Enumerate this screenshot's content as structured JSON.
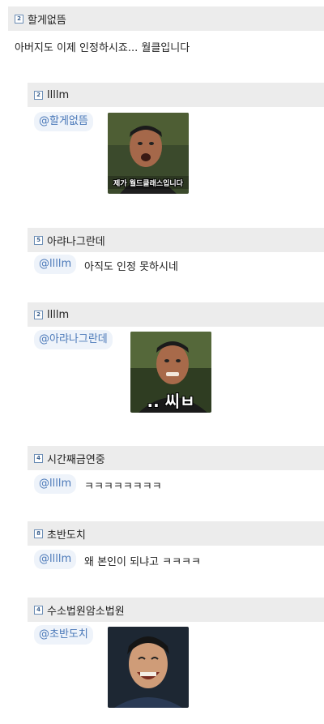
{
  "main_comment": {
    "level_icon": "level-badge-icon",
    "nickname": "할게없뜸",
    "text": "아버지도 이제 인정하시죠... 월클입니다"
  },
  "replies": [
    {
      "nickname": "llllm",
      "mention": "@할게없뜸",
      "text": "",
      "image_caption": "제가 월드클래스입니다"
    },
    {
      "nickname": "아랴나그란데",
      "mention": "@llllm",
      "text": "아직도 인정 못하시네"
    },
    {
      "nickname": "llllm",
      "mention": "@아랴나그란데",
      "text": "",
      "image_caption": ".. 씨ㅂ"
    },
    {
      "nickname": "시간째금연중",
      "mention": "@llllm",
      "text": "ㅋㅋㅋㅋㅋㅋㅋㅋ"
    },
    {
      "nickname": "초반도치",
      "mention": "@llllm",
      "text": "왜 본인이 되냐고 ㅋㅋㅋㅋ"
    },
    {
      "nickname": "수소법원암소법원",
      "mention": "@초반도치",
      "text": ""
    }
  ],
  "colors": {
    "header_bg": "#ececec",
    "mention_text": "#4a78b8",
    "mention_bg": "#eef3fa"
  }
}
